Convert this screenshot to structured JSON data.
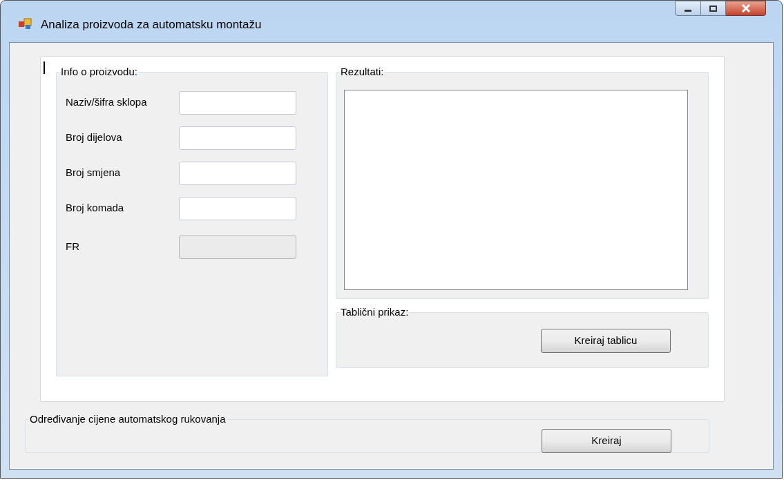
{
  "window": {
    "title": "Analiza proizvoda za automatsku montažu"
  },
  "info_group": {
    "title": "Info o proizvodu:",
    "fields": [
      {
        "label": "Naziv/šifra sklopa",
        "disabled": false
      },
      {
        "label": "Broj dijelova",
        "disabled": false
      },
      {
        "label": "Broj smjena",
        "disabled": false
      },
      {
        "label": "Broj komada",
        "disabled": false
      },
      {
        "label": "FR",
        "disabled": true
      }
    ]
  },
  "results_group": {
    "title": "Rezultati:"
  },
  "table_group": {
    "title": "Tablični prikaz:",
    "button": "Kreiraj tablicu"
  },
  "price_group": {
    "title": "Određivanje cijene automatskog rukovanja",
    "button": "Kreiraj"
  }
}
